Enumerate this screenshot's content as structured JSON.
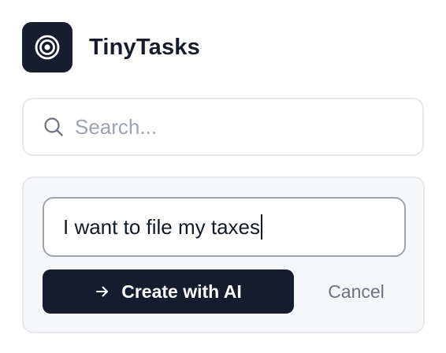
{
  "app": {
    "title": "TinyTasks",
    "logo_icon": "target-icon",
    "brand_color": "#161b2e"
  },
  "search": {
    "placeholder": "Search...",
    "value": "",
    "icon": "search-icon"
  },
  "create_panel": {
    "task_input_value": "I want to file my taxes",
    "create_button_label": "Create with AI",
    "create_button_icon": "arrow-right-icon",
    "cancel_button_label": "Cancel"
  }
}
